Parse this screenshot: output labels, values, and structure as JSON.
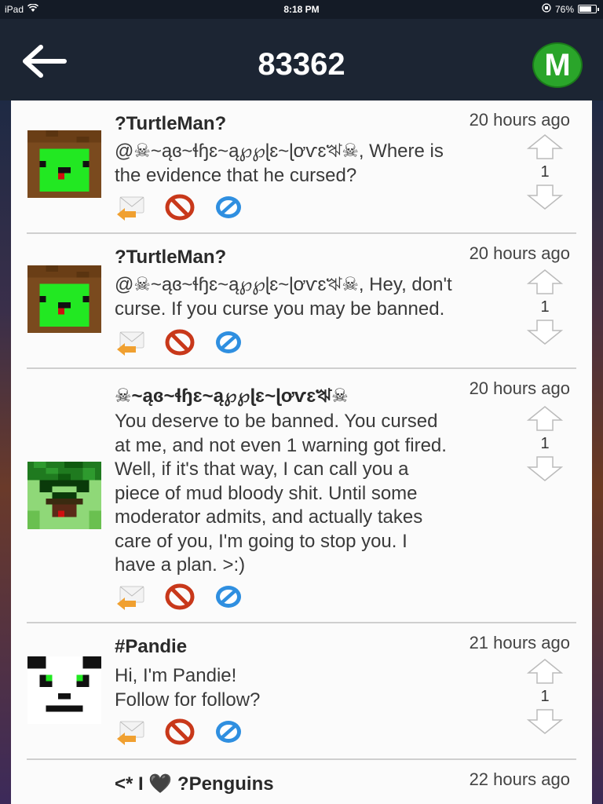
{
  "status_bar": {
    "device": "iPad",
    "time": "8:18 PM",
    "battery": "76%",
    "battery_level": 0.76
  },
  "header": {
    "title": "83362",
    "back_icon": "arrow-left-icon",
    "badge_letter": "M"
  },
  "colors": {
    "header_bg": "#1c2533",
    "badge_green": "#2aa52a",
    "reply_orange": "#f0a030",
    "block_red": "#c8381a",
    "flag_blue": "#2f8fe0"
  },
  "comments": [
    {
      "username": "?TurtleMan?",
      "time": "20 hours ago",
      "text": "@☠~ąɞ~ɬɧɛ~ą℘℘ɭɛ~ɭơѵɛঋ☠, Where is\nthe evidence that he cursed?",
      "votes": "1",
      "avatar": "turtle-avatar"
    },
    {
      "username": "?TurtleMan?",
      "time": "20 hours ago",
      "text": "@☠~ąɞ~ɬɧɛ~ą℘℘ɭɛ~ɭơѵɛঋ☠, Hey, don't\ncurse. If you curse you may be banned.",
      "votes": "1",
      "avatar": "turtle-avatar"
    },
    {
      "username": "☠~ąɞ~ɬɧɛ~ą℘℘ɭɛ~ɭơѵɛঋ☠",
      "time": "20 hours ago",
      "text": "You deserve to be banned. You cursed\nat me, and not even 1 warning got fired.\nWell, if it's that way, I can call you a\npiece of mud bloody shit. Until some\nmoderator admits, and actually takes\ncare of you, I'm going to stop you. I\nhave a plan. >:)",
      "votes": "1",
      "avatar": "creeper-avatar"
    },
    {
      "username": "#Pandie",
      "time": "21 hours ago",
      "text": "Hi, I'm Pandie!\nFollow for follow?",
      "votes": "1",
      "avatar": "panda-avatar"
    },
    {
      "username": "<* I 🖤 ?Penguins",
      "time": "22 hours ago",
      "text": "",
      "votes": "",
      "avatar": ""
    }
  ]
}
